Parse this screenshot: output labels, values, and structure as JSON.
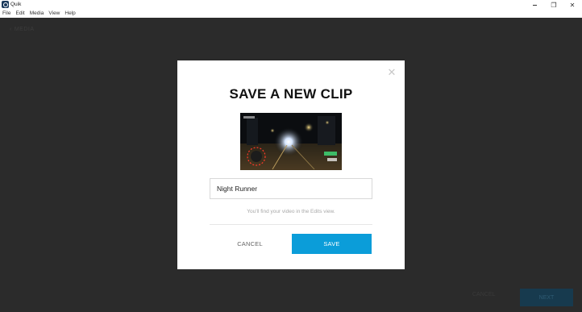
{
  "window": {
    "title": "Quik",
    "controls": {
      "minimize": "",
      "maximize": "❐",
      "close": "✕"
    }
  },
  "menu": {
    "items": [
      {
        "label": "File"
      },
      {
        "label": "Edit"
      },
      {
        "label": "Media"
      },
      {
        "label": "View"
      },
      {
        "label": "Help"
      }
    ]
  },
  "background": {
    "back_label": "MEDIA",
    "cancel_label": "CANCEL",
    "next_label": "NEXT"
  },
  "modal": {
    "title": "SAVE A NEW CLIP",
    "thumbnail_icon": "video-thumbnail",
    "name_value": "Night Runner",
    "hint": "You'll find your video in the Edits view.",
    "cancel_label": "CANCEL",
    "save_label": "SAVE",
    "close_icon": "✕"
  },
  "colors": {
    "overlay": "#2b2b2b",
    "accent": "#0b9dd9",
    "modal_bg": "#ffffff"
  }
}
